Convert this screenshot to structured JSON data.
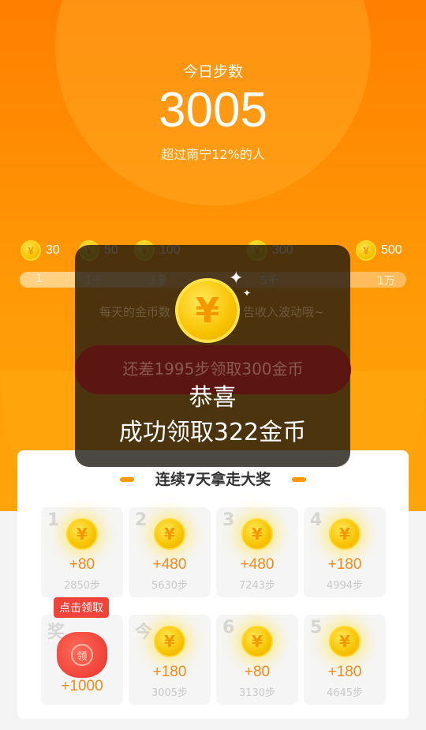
{
  "header": {
    "title": "今日步数",
    "steps": "3005",
    "subtitle": "超过南宁12%的人"
  },
  "rewards": [
    {
      "coins": "30"
    },
    {
      "coins": "50"
    },
    {
      "coins": "100"
    },
    {
      "coins": "300"
    },
    {
      "coins": "500"
    }
  ],
  "progress": {
    "ticks": [
      "1",
      "1千",
      "3千",
      "5千",
      "1万"
    ],
    "current_steps": 3005,
    "max_steps": 10000
  },
  "note": {
    "left": "每天的金币数",
    "right": "告收入波动哦~"
  },
  "action_button": "还差1995步领取300金币",
  "streak": {
    "title": "连续7天拿走大奖",
    "days": [
      {
        "label": "1",
        "amount": "+80",
        "steps": "2850步"
      },
      {
        "label": "2",
        "amount": "+480",
        "steps": "5630步"
      },
      {
        "label": "3",
        "amount": "+480",
        "steps": "7243步"
      },
      {
        "label": "4",
        "amount": "+180",
        "steps": "4994步"
      },
      {
        "label": "5",
        "amount": "+180",
        "steps": "4645步"
      },
      {
        "label": "6",
        "amount": "+80",
        "steps": "3130步"
      },
      {
        "label": "今",
        "amount": "+180",
        "steps": "3005步"
      }
    ],
    "prize": {
      "label": "奖",
      "amount": "+1000",
      "bag_text": "领",
      "tooltip": "点击领取"
    }
  },
  "dialog": {
    "line1": "恭喜",
    "line2": "成功领取322金币",
    "coin_symbol": "¥"
  },
  "colors": {
    "orange": "#ff8a00",
    "accent_text": "#f08a1a",
    "button_red": "#ff3b1e"
  }
}
